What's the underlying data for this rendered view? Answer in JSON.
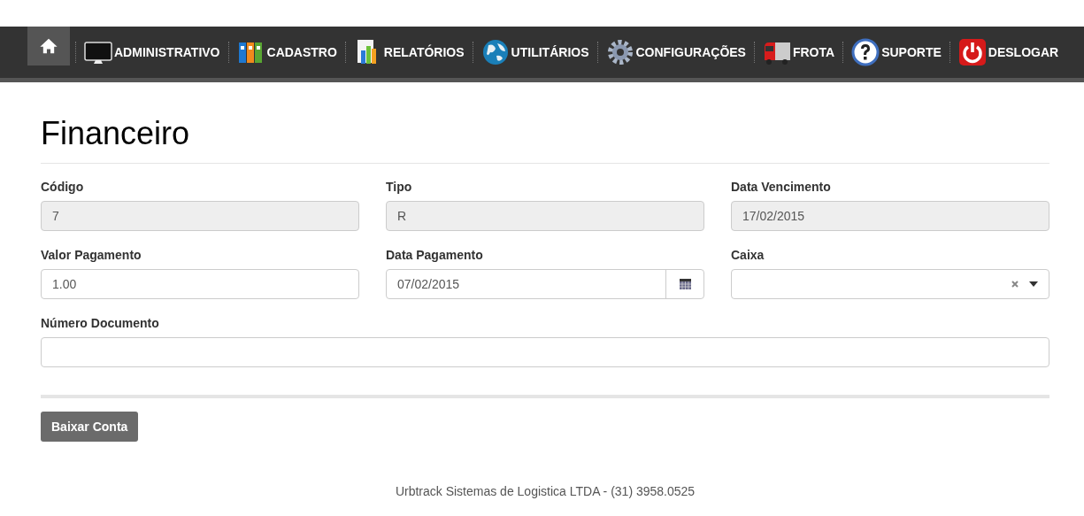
{
  "nav": [
    {
      "selected": true
    },
    {
      "label": "ADMINISTRATIVO",
      "selected": false
    },
    {
      "label": "CADASTRO",
      "selected": false
    },
    {
      "label": "RELATÓRIOS",
      "selected": false
    },
    {
      "label": "UTILITÁRIOS",
      "selected": false
    },
    {
      "label": "CONFIGURAÇÕES",
      "selected": false
    },
    {
      "label": "FROTA",
      "selected": false
    },
    {
      "label": "SUPORTE",
      "selected": false
    },
    {
      "label": "DESLOGAR",
      "selected": false
    }
  ],
  "title": "Financeiro",
  "fields": [
    {
      "label": "Código",
      "kind": "readonly",
      "value": "7"
    },
    {
      "label": "Tipo",
      "kind": "readonly",
      "value": "R"
    },
    {
      "label": "Data Vencimento",
      "kind": "readonly",
      "value": "17/02/2015"
    },
    {
      "label": "Valor Pagamento",
      "kind": "text",
      "value": "1.00"
    },
    {
      "label": "Data Pagamento",
      "kind": "date",
      "value": "07/02/2015"
    },
    {
      "label": "Caixa",
      "kind": "select"
    },
    {
      "label": "Número Documento",
      "kind": "wide"
    }
  ],
  "button": "Baixar Conta",
  "footer": "Urbtrack Sistemas de Logistica LTDA - (31) 3958.0525"
}
